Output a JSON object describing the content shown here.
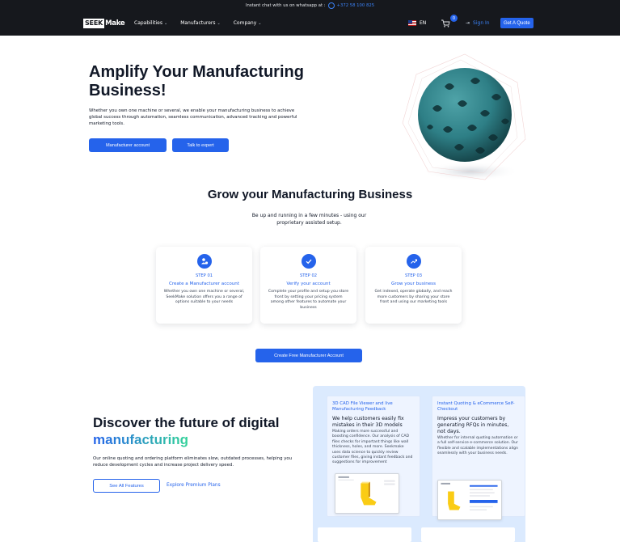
{
  "topbar": {
    "text": "Instant chat with us on whatsapp at :",
    "phone": "+372 58 100 825"
  },
  "nav": {
    "logo_box": "SEEK",
    "logo_rest": "Make",
    "menu": [
      "Capabilities",
      "Manufacturers",
      "Company"
    ],
    "language": "EN",
    "cart_count": "0",
    "signin": "Sign In",
    "quote": "Get A Quote"
  },
  "hero": {
    "title": "Amplify Your Manufacturing Business!",
    "text": "Whether you own one machine or several, we enable your manufacturing business to achieve global success through automation, seamless communication, advanced tracking and powerful marketing tools.",
    "btn_manufacturer": "Manufacturer account",
    "btn_expert": "Talk to expert"
  },
  "grow": {
    "title": "Grow your Manufacturing Business",
    "subtitle": "Be up and running in a few minutes - using our proprietary assisted setup.",
    "steps": [
      {
        "number": "STEP 01",
        "title": "Create a Manufacturer account",
        "text": "Whether you own one machine or several, SeekMake solution offers you a range of options suitable to your needs"
      },
      {
        "number": "STEP 02",
        "title": "Verify your account",
        "text": "Complete your profile and setup you store front by setting your pricing system among other features to automate your business"
      },
      {
        "number": "STEP 03",
        "title": "Grow your business",
        "text": "Get indexed, operate globally, and reach more customers by sharing your store front and using our marketing tools"
      }
    ],
    "create_btn": "Create Free Manufacturer Account"
  },
  "discover": {
    "title_line1": "Discover the future of digital",
    "title_line2": "manufacturing",
    "text": "Our online quoting and ordering platform eliminates slow, outdated processes, helping you reduce development cycles and increase project delivery speed.",
    "btn_features": "See All Features",
    "link_plans": "Explore Premium Plans"
  },
  "cards": [
    {
      "head": "3D CAD File Viewer and live Manufacturing Feedback",
      "lead": "We help customers easily fix mistakes in their 3D models",
      "body": "Making orders more successful and boosting confidence. Our analysis of CAD files checks for important things like wall thickness, holes, and more. Seekmake uses data science to quickly review customer files, giving instant feedback and suggestions for improvement"
    },
    {
      "head": "Instant Quoting & eCommerce Self-Checkout",
      "lead": "Impress your customers by generating RFQs in minutes, not days.",
      "body": "Whether for internal quoting automation or a full self-service e-commerce solution. Our flexible and scalable implementations align seamlessly with your business needs."
    }
  ],
  "colors": {
    "accent": "#2563eb",
    "nav_bg": "#16181d",
    "teal_object": "#2e7f86",
    "panel": "#dbeafe"
  }
}
